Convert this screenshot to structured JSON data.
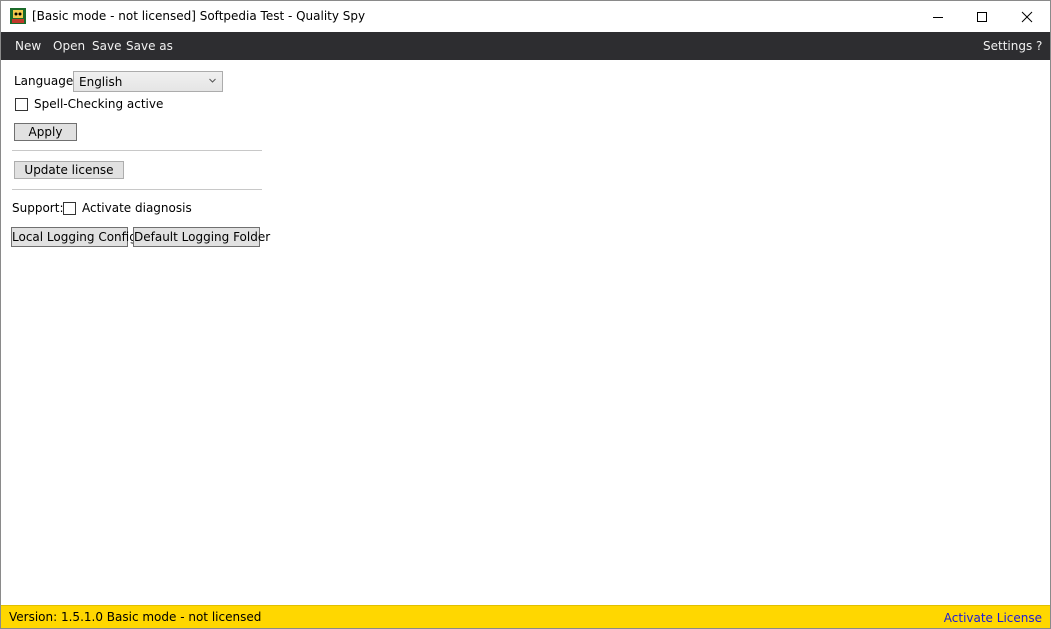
{
  "window": {
    "title": "[Basic mode - not licensed] Softpedia Test - Quality Spy"
  },
  "menu": {
    "new": "New",
    "open": "Open",
    "save": "Save",
    "save_as": "Save as",
    "settings": "Settings",
    "help": "?"
  },
  "settings_panel": {
    "language_label": "Language",
    "language_value": "English",
    "spellcheck_label": "Spell-Checking active",
    "spellcheck_checked": false,
    "apply_button": "Apply",
    "update_license_button": "Update license",
    "support_label": "Support:",
    "diagnosis_label": "Activate diagnosis",
    "diagnosis_checked": false,
    "local_logging_button": "Local Logging Config",
    "default_logging_button": "Default Logging Folder"
  },
  "statusbar": {
    "version_text": "Version: 1.5.1.0  Basic mode - not licensed",
    "activate_link": "Activate License"
  },
  "colors": {
    "menubar_bg": "#2d2d30",
    "statusbar_bg": "#ffd700",
    "link": "#1a1adb"
  }
}
